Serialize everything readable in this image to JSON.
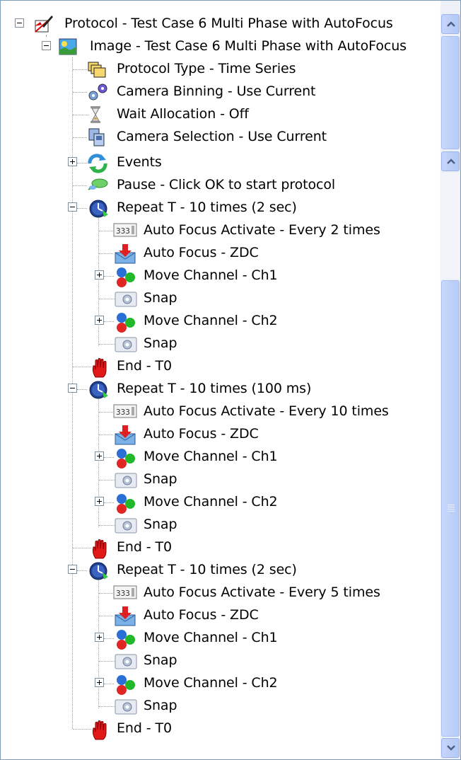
{
  "tree": {
    "root_label": "Protocol - Test Case 6 Multi Phase with AutoFocus",
    "image_label": "Image - Test Case 6 Multi Phase with AutoFocus",
    "protocol_type": "Protocol Type - Time Series",
    "camera_binning": "Camera Binning - Use Current",
    "wait_allocation": "Wait Allocation - Off",
    "camera_selection": "Camera Selection - Use Current",
    "events": "Events",
    "pause": "Pause - Click OK to start protocol",
    "repeat_blocks": [
      {
        "repeat": "Repeat T - 10 times (2 sec)",
        "af_activate": "Auto Focus Activate - Every 2 times",
        "af": "Auto Focus - ZDC",
        "move1": "Move Channel - Ch1",
        "snap1": "Snap",
        "move2": "Move Channel - Ch2",
        "snap2": "Snap",
        "end": "End - T0"
      },
      {
        "repeat": "Repeat T - 10 times (100 ms)",
        "af_activate": "Auto Focus Activate - Every 10 times",
        "af": "Auto Focus - ZDC",
        "move1": "Move Channel - Ch1",
        "snap1": "Snap",
        "move2": "Move Channel - Ch2",
        "snap2": "Snap",
        "end": "End - T0"
      },
      {
        "repeat": "Repeat T - 10 times (2 sec)",
        "af_activate": "Auto Focus Activate - Every 5 times",
        "af": "Auto Focus - ZDC",
        "move1": "Move Channel - Ch1",
        "snap1": "Snap",
        "move2": "Move Channel - Ch2",
        "snap2": "Snap",
        "end": "End - T0"
      }
    ]
  },
  "colors": {
    "panel_border": "#7f9db9",
    "scroll_track": "#eef0f7",
    "scroll_button": "#c6d5fb"
  },
  "icons": {
    "root": "protocol-pen-icon",
    "image": "image-landscape-icon",
    "protocol_type": "folders-icon",
    "camera_binning": "gears-icon",
    "wait_allocation": "hourglass-icon",
    "camera_selection": "film-frames-icon",
    "events": "refresh-arrows-icon",
    "pause": "speech-bubble-icon",
    "repeat": "clock-icon",
    "af_activate": "counter-icon",
    "af": "envelope-arrow-down-icon",
    "move": "color-balls-icon",
    "snap": "camera-icon",
    "end": "stop-hand-icon"
  }
}
